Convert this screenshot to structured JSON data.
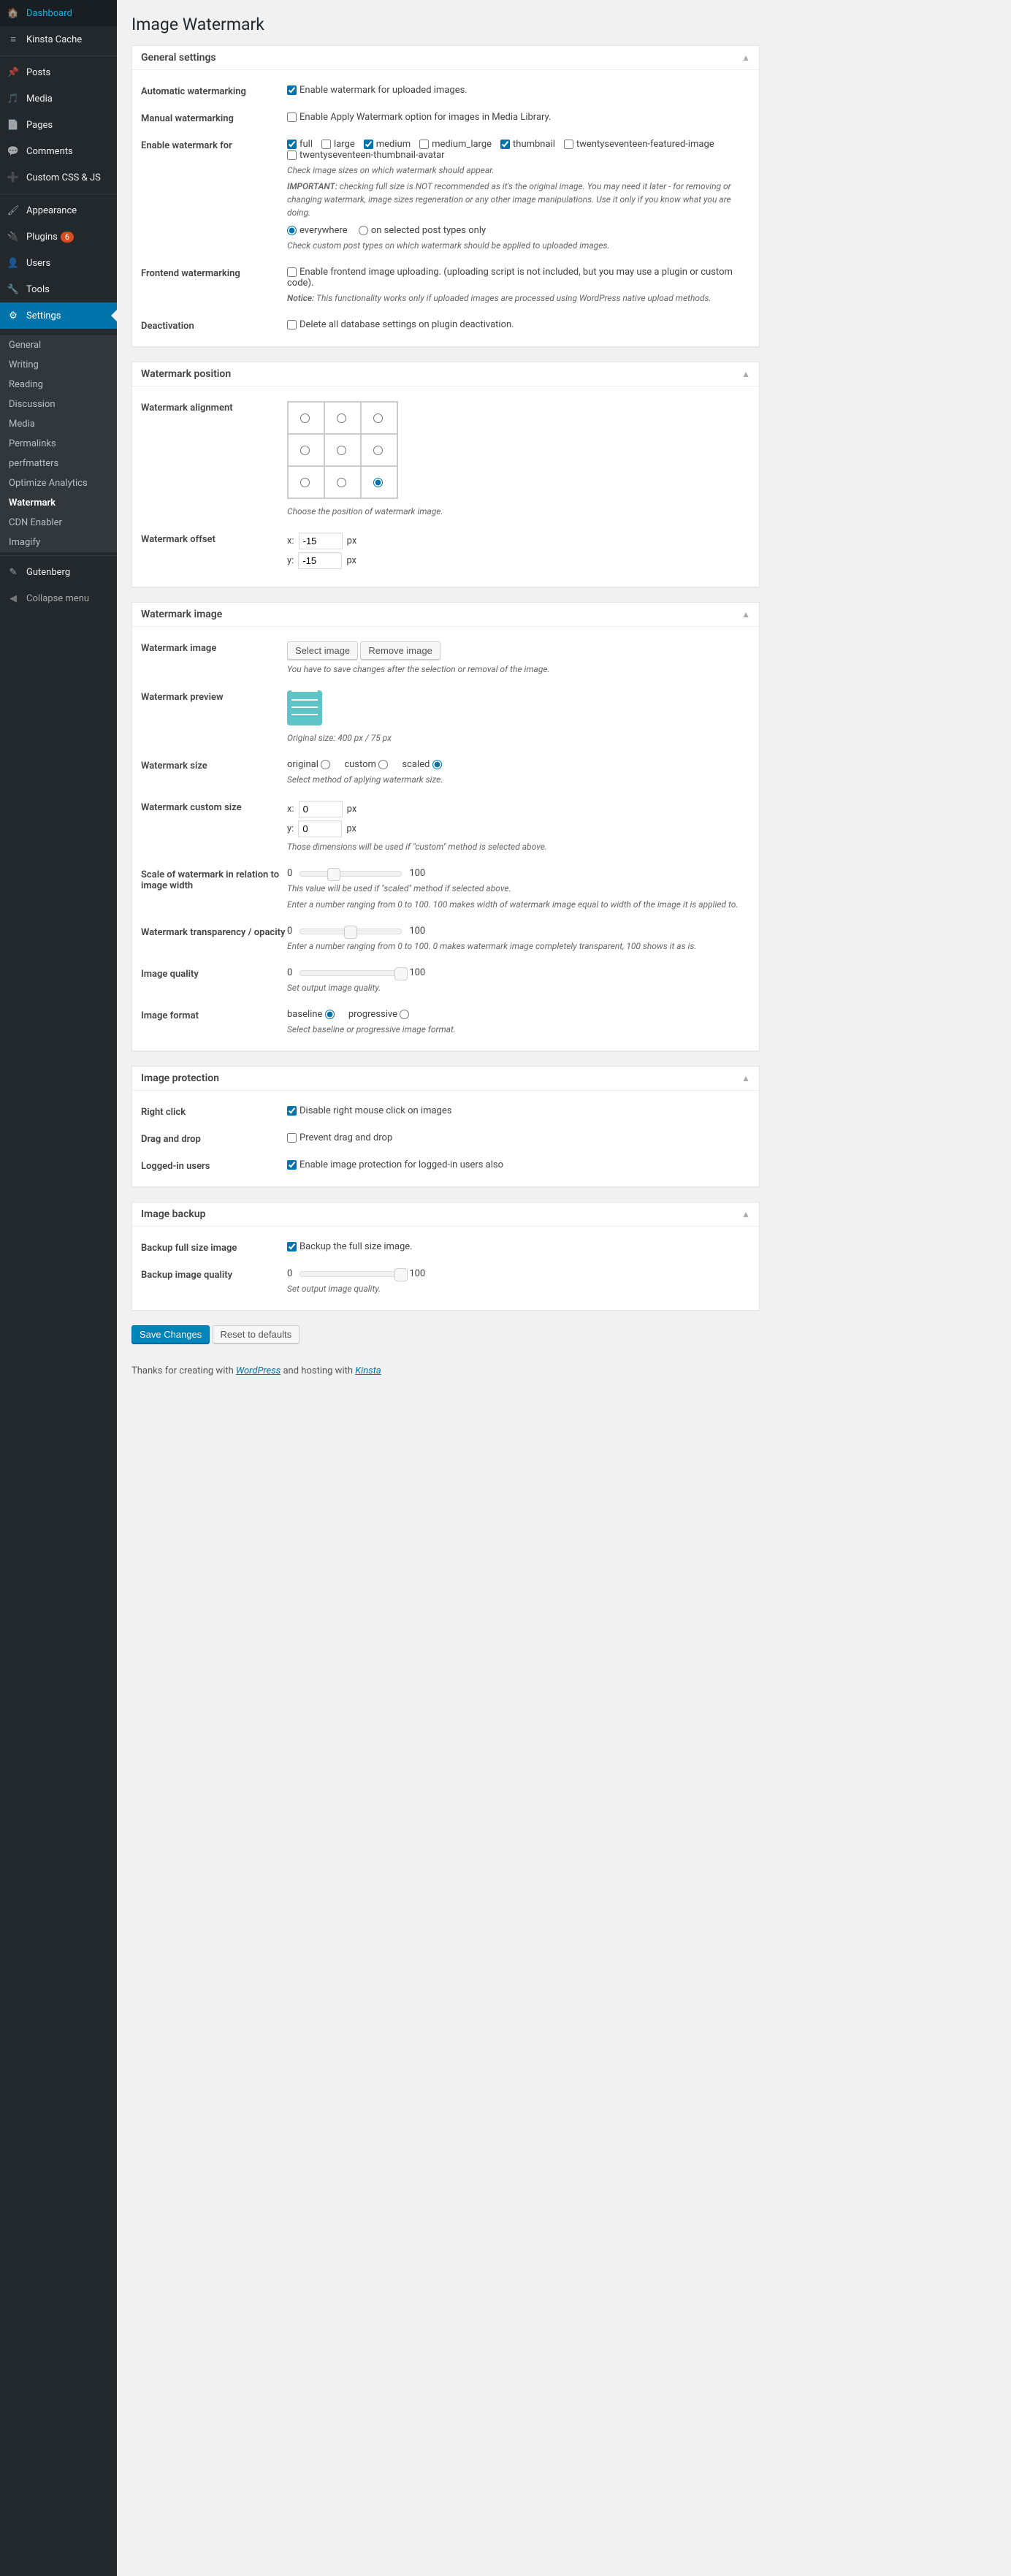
{
  "page_title": "Image Watermark",
  "sidebar": {
    "items": [
      {
        "icon": "dashboard",
        "label": "Dashboard"
      },
      {
        "icon": "cache",
        "label": "Kinsta Cache"
      },
      {
        "icon": "pin",
        "label": "Posts"
      },
      {
        "icon": "media",
        "label": "Media"
      },
      {
        "icon": "pages",
        "label": "Pages"
      },
      {
        "icon": "comments",
        "label": "Comments"
      },
      {
        "icon": "css",
        "label": "Custom CSS & JS"
      },
      {
        "icon": "appearance",
        "label": "Appearance"
      },
      {
        "icon": "plugins",
        "label": "Plugins",
        "badge": "6"
      },
      {
        "icon": "users",
        "label": "Users"
      },
      {
        "icon": "tools",
        "label": "Tools"
      },
      {
        "icon": "settings",
        "label": "Settings",
        "active": true
      }
    ],
    "submenu": [
      {
        "label": "General"
      },
      {
        "label": "Writing"
      },
      {
        "label": "Reading"
      },
      {
        "label": "Discussion"
      },
      {
        "label": "Media"
      },
      {
        "label": "Permalinks"
      },
      {
        "label": "perfmatters"
      },
      {
        "label": "Optimize Analytics"
      },
      {
        "label": "Watermark",
        "active": true
      },
      {
        "label": "CDN Enabler"
      },
      {
        "label": "Imagify"
      }
    ],
    "bottom": [
      {
        "icon": "gutenberg",
        "label": "Gutenberg"
      }
    ],
    "collapse": "Collapse menu"
  },
  "panels": {
    "general": {
      "title": "General settings",
      "auto_label": "Automatic watermarking",
      "auto_check": "Enable watermark for uploaded images.",
      "manual_label": "Manual watermarking",
      "manual_check": "Enable Apply Watermark option for images in Media Library.",
      "enable_for_label": "Enable watermark for",
      "sizes": [
        "full",
        "large",
        "medium",
        "medium_large",
        "thumbnail",
        "twentyseventeen-featured-image",
        "twentyseventeen-thumbnail-avatar"
      ],
      "sizes_desc": "Check image sizes on which watermark should appear.",
      "sizes_important": "IMPORTANT:",
      "sizes_important_text": " checking full size is NOT recommended as it's the original image. You may need it later - for removing or changing watermark, image sizes regeneration or any other image manipulations. Use it only if you know what you are doing.",
      "posttypes_everywhere": "everywhere",
      "posttypes_selected": "on selected post types only",
      "posttypes_desc": "Check custom post types on which watermark should be applied to uploaded images.",
      "frontend_label": "Frontend watermarking",
      "frontend_check": "Enable frontend image uploading. (uploading script is not included, but you may use a plugin or custom code).",
      "frontend_notice_b": "Notice:",
      "frontend_notice": " This functionality works only if uploaded images are processed using WordPress native upload methods.",
      "deactivation_label": "Deactivation",
      "deactivation_check": "Delete all database settings on plugin deactivation."
    },
    "position": {
      "title": "Watermark position",
      "align_label": "Watermark alignment",
      "align_desc": "Choose the position of watermark image.",
      "offset_label": "Watermark offset",
      "x": "x:",
      "y": "y:",
      "px": "px",
      "x_val": "-15",
      "y_val": "-15"
    },
    "image": {
      "title": "Watermark image",
      "img_label": "Watermark image",
      "select_btn": "Select image",
      "remove_btn": "Remove image",
      "img_desc": "You have to save changes after the selection or removal of the image.",
      "preview_label": "Watermark preview",
      "preview_desc": "Original size: 400 px / 75 px",
      "size_label": "Watermark size",
      "size_original": "original",
      "size_custom": "custom",
      "size_scaled": "scaled",
      "size_desc": "Select method of aplying watermark size.",
      "custom_label": "Watermark custom size",
      "custom_x": "0",
      "custom_y": "0",
      "custom_desc": "Those dimensions will be used if \"custom\" method is selected above.",
      "scale_label": "Scale of watermark in relation to image width",
      "scale_min": "0",
      "scale_max": "100",
      "scale_desc1": "This value will be used if \"scaled\" method if selected above.",
      "scale_desc2": "Enter a number ranging from 0 to 100. 100 makes width of watermark image equal to width of the image it is applied to.",
      "opacity_label": "Watermark transparency / opacity",
      "opacity_desc": "Enter a number ranging from 0 to 100. 0 makes watermark image completely transparent, 100 shows it as is.",
      "quality_label": "Image quality",
      "quality_desc": "Set output image quality.",
      "format_label": "Image format",
      "format_baseline": "baseline",
      "format_progressive": "progressive",
      "format_desc": "Select baseline or progressive image format."
    },
    "protection": {
      "title": "Image protection",
      "rightclick_label": "Right click",
      "rightclick_check": "Disable right mouse click on images",
      "drag_label": "Drag and drop",
      "drag_check": "Prevent drag and drop",
      "logged_label": "Logged-in users",
      "logged_check": "Enable image protection for logged-in users also"
    },
    "backup": {
      "title": "Image backup",
      "full_label": "Backup full size image",
      "full_check": "Backup the full size image.",
      "quality_label": "Backup image quality",
      "quality_desc": "Set output image quality."
    }
  },
  "actions": {
    "save": "Save Changes",
    "reset": "Reset to defaults"
  },
  "footer": {
    "pre": "Thanks for creating with ",
    "wp": "WordPress",
    "mid": " and hosting with ",
    "kinsta": "Kinsta"
  }
}
